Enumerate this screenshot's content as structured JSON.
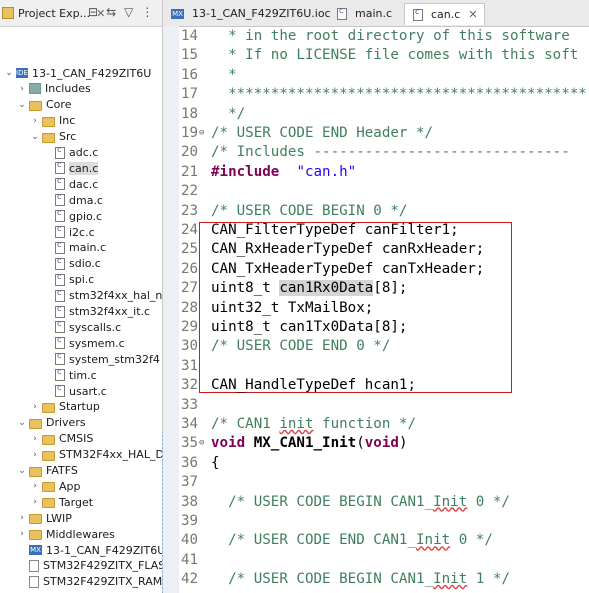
{
  "explorer": {
    "tab_label": "Project Exp...",
    "tree": [
      {
        "label": "13-1_CAN_F429ZIT6U",
        "icon": "project-icon",
        "depth": 0,
        "open": true
      },
      {
        "label": "Includes",
        "icon": "includes-icon",
        "depth": 1,
        "open": false
      },
      {
        "label": "Core",
        "icon": "folder-icon",
        "depth": 1,
        "open": true
      },
      {
        "label": "Inc",
        "icon": "folder-icon",
        "depth": 2,
        "open": false
      },
      {
        "label": "Src",
        "icon": "folder-icon",
        "depth": 2,
        "open": true
      },
      {
        "label": "adc.c",
        "icon": "c-file-icon",
        "depth": 3
      },
      {
        "label": "can.c",
        "icon": "c-file-icon",
        "depth": 3,
        "selected": true
      },
      {
        "label": "dac.c",
        "icon": "c-file-icon",
        "depth": 3
      },
      {
        "label": "dma.c",
        "icon": "c-file-icon",
        "depth": 3
      },
      {
        "label": "gpio.c",
        "icon": "c-file-icon",
        "depth": 3
      },
      {
        "label": "i2c.c",
        "icon": "c-file-icon",
        "depth": 3
      },
      {
        "label": "main.c",
        "icon": "c-file-icon",
        "depth": 3
      },
      {
        "label": "sdio.c",
        "icon": "c-file-icon",
        "depth": 3
      },
      {
        "label": "spi.c",
        "icon": "c-file-icon",
        "depth": 3
      },
      {
        "label": "stm32f4xx_hal_n",
        "icon": "c-file-icon",
        "depth": 3
      },
      {
        "label": "stm32f4xx_it.c",
        "icon": "c-file-icon",
        "depth": 3
      },
      {
        "label": "syscalls.c",
        "icon": "c-file-icon",
        "depth": 3
      },
      {
        "label": "sysmem.c",
        "icon": "c-file-icon",
        "depth": 3
      },
      {
        "label": "system_stm32f4",
        "icon": "c-file-icon",
        "depth": 3
      },
      {
        "label": "tim.c",
        "icon": "c-file-icon",
        "depth": 3
      },
      {
        "label": "usart.c",
        "icon": "c-file-icon",
        "depth": 3
      },
      {
        "label": "Startup",
        "icon": "folder-icon",
        "depth": 2,
        "open": false
      },
      {
        "label": "Drivers",
        "icon": "folder-icon",
        "depth": 1,
        "open": true
      },
      {
        "label": "CMSIS",
        "icon": "folder-icon",
        "depth": 2,
        "open": false
      },
      {
        "label": "STM32F4xx_HAL_D",
        "icon": "folder-icon",
        "depth": 2,
        "open": false
      },
      {
        "label": "FATFS",
        "icon": "folder-icon",
        "depth": 1,
        "open": true
      },
      {
        "label": "App",
        "icon": "folder-icon",
        "depth": 2,
        "open": false
      },
      {
        "label": "Target",
        "icon": "folder-icon",
        "depth": 2,
        "open": false
      },
      {
        "label": "LWIP",
        "icon": "folder-icon",
        "depth": 1,
        "open": false
      },
      {
        "label": "Middlewares",
        "icon": "folder-icon",
        "depth": 1,
        "open": false
      },
      {
        "label": "13-1_CAN_F429ZIT6U.",
        "icon": "mx-icon",
        "depth": 1
      },
      {
        "label": "STM32F429ZITX_FLAS",
        "icon": "file-icon",
        "depth": 1
      },
      {
        "label": "STM32F429ZITX_RAM.",
        "icon": "file-icon",
        "depth": 1
      }
    ]
  },
  "editor_tabs": [
    {
      "label": "13-1_CAN_F429ZIT6U.ioc",
      "icon": "mx-icon",
      "active": false
    },
    {
      "label": "main.c",
      "icon": "c-file-icon",
      "active": false
    },
    {
      "label": "can.c",
      "icon": "c-file-icon",
      "active": true
    }
  ],
  "code": [
    {
      "n": "14",
      "fold": "",
      "parts": [
        [
          "cm",
          "  * in the root directory of this software"
        ]
      ]
    },
    {
      "n": "15",
      "fold": "",
      "parts": [
        [
          "cm",
          "  * If no LICENSE file comes with this soft"
        ]
      ]
    },
    {
      "n": "16",
      "fold": "",
      "parts": [
        [
          "cm",
          "  *"
        ]
      ]
    },
    {
      "n": "17",
      "fold": "",
      "parts": [
        [
          "cm",
          "  ******************************************"
        ]
      ]
    },
    {
      "n": "18",
      "fold": "",
      "parts": [
        [
          "cm",
          "  */"
        ]
      ]
    },
    {
      "n": "19",
      "fold": "⊖",
      "parts": [
        [
          "cm",
          "/* USER CODE END Header */"
        ]
      ]
    },
    {
      "n": "20",
      "fold": "",
      "parts": [
        [
          "cm",
          "/* Includes ------------------------------"
        ]
      ]
    },
    {
      "n": "21",
      "fold": "",
      "parts": [
        [
          "kw",
          "#include"
        ],
        [
          "",
          "  "
        ],
        [
          "str",
          "\"can.h\""
        ]
      ]
    },
    {
      "n": "22",
      "fold": "",
      "parts": []
    },
    {
      "n": "23",
      "fold": "",
      "parts": [
        [
          "cm",
          "/* USER CODE BEGIN 0 */"
        ]
      ]
    },
    {
      "n": "24",
      "fold": "",
      "parts": [
        [
          "",
          "CAN_FilterTypeDef canFilter1;"
        ]
      ]
    },
    {
      "n": "25",
      "fold": "",
      "parts": [
        [
          "",
          "CAN_RxHeaderTypeDef canRxHeader;"
        ]
      ]
    },
    {
      "n": "26",
      "fold": "",
      "parts": [
        [
          "",
          "CAN_TxHeaderTypeDef canTxHeader;"
        ]
      ]
    },
    {
      "n": "27",
      "fold": "",
      "parts": [
        [
          "",
          "uint8_t "
        ],
        [
          "hl",
          "can1Rx0Data"
        ],
        [
          "",
          "[8];"
        ]
      ]
    },
    {
      "n": "28",
      "fold": "",
      "parts": [
        [
          "",
          "uint32_t TxMailBox;"
        ]
      ]
    },
    {
      "n": "29",
      "fold": "",
      "parts": [
        [
          "",
          "uint8_t can1Tx0Data[8];"
        ]
      ]
    },
    {
      "n": "30",
      "fold": "",
      "parts": [
        [
          "cm",
          "/* USER CODE END 0 */"
        ]
      ]
    },
    {
      "n": "31",
      "fold": "",
      "parts": []
    },
    {
      "n": "32",
      "fold": "",
      "parts": [
        [
          "",
          "CAN_HandleTypeDef hcan1;"
        ]
      ]
    },
    {
      "n": "33",
      "fold": "",
      "parts": []
    },
    {
      "n": "34",
      "fold": "",
      "parts": [
        [
          "cm",
          "/* CAN1 "
        ],
        [
          "cm sq",
          "init"
        ],
        [
          "cm",
          " function */"
        ]
      ]
    },
    {
      "n": "35",
      "fold": "⊖",
      "parts": [
        [
          "kw",
          "void"
        ],
        [
          "",
          " "
        ],
        [
          "fn",
          "MX_CAN1_Init"
        ],
        [
          "",
          "("
        ],
        [
          "kw",
          "void"
        ],
        [
          "",
          ")"
        ]
      ]
    },
    {
      "n": "36",
      "fold": "",
      "parts": [
        [
          "",
          "{"
        ]
      ]
    },
    {
      "n": "37",
      "fold": "",
      "parts": []
    },
    {
      "n": "38",
      "fold": "",
      "parts": [
        [
          "cm",
          "  /* USER CODE BEGIN CAN1_"
        ],
        [
          "cm sq",
          "Init"
        ],
        [
          "cm",
          " 0 */"
        ]
      ]
    },
    {
      "n": "39",
      "fold": "",
      "parts": []
    },
    {
      "n": "40",
      "fold": "",
      "parts": [
        [
          "cm",
          "  /* USER CODE END CAN1_"
        ],
        [
          "cm sq",
          "Init"
        ],
        [
          "cm",
          " 0 */"
        ]
      ]
    },
    {
      "n": "41",
      "fold": "",
      "parts": []
    },
    {
      "n": "42",
      "fold": "",
      "parts": [
        [
          "cm",
          "  /* USER CODE BEGIN CAN1_"
        ],
        [
          "cm sq",
          "Init"
        ],
        [
          "cm",
          " 1 */"
        ]
      ]
    }
  ]
}
